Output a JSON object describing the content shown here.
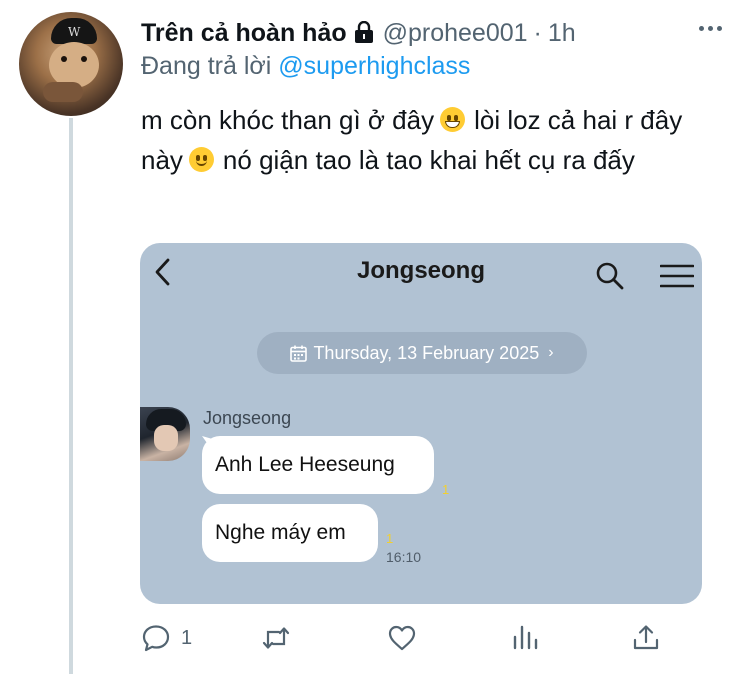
{
  "tweet": {
    "display_name": "Trên cả hoàn hảo",
    "handle": "@prohee001",
    "separator": "·",
    "time": "1h",
    "reply_prefix": "Đang trả lời",
    "reply_mention": "@superhighclass",
    "text_part1": "m còn khóc than gì ở đây",
    "text_part2": "lòi loz cả hai r đây này",
    "text_part3": "nó giận tao là tao khai hết cụ ra đấy"
  },
  "media": {
    "chat_title": "Jongseong",
    "date_label": "Thursday, 13 February 2025",
    "date_chevron": "›",
    "sender_name": "Jongseong",
    "messages": [
      {
        "text": "Anh Lee Heeseung",
        "read_count": "1"
      },
      {
        "text": "Nghe máy em",
        "read_count": "1",
        "time": "16:10"
      }
    ],
    "background_color": "#b1c2d3"
  },
  "actions": {
    "reply_count": "1"
  },
  "colors": {
    "text_primary": "#0f1419",
    "text_secondary": "#536471",
    "link": "#1d9bf0",
    "thread_line": "#cfd9de"
  },
  "icons": [
    "lock-icon",
    "more-icon",
    "grinning-emoji",
    "smile-emoji",
    "back-icon",
    "search-icon",
    "menu-icon",
    "calendar-icon",
    "reply-icon",
    "retweet-icon",
    "like-icon",
    "views-icon",
    "share-icon"
  ]
}
